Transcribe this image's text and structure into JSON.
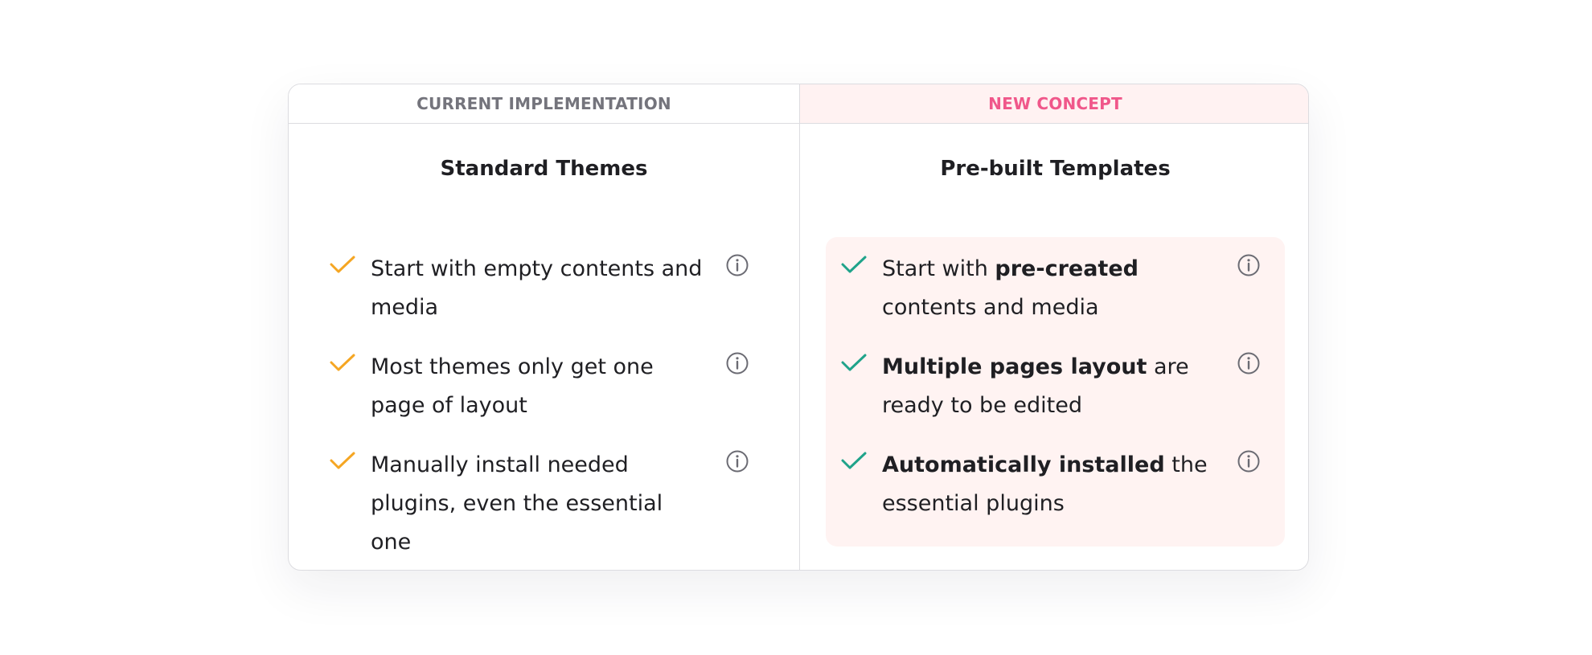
{
  "left_column": {
    "header": "CURRENT IMPLEMENTATION",
    "title": "Standard Themes",
    "features": [
      {
        "text": "Start with empty contents and media"
      },
      {
        "text": "Most themes only get one page of layout"
      },
      {
        "text": "Manually install needed plugins, even the essential one"
      }
    ]
  },
  "right_column": {
    "header": "NEW CONCEPT",
    "title": "Pre-built Templates",
    "features": [
      {
        "pre": "Start with ",
        "bold": "pre-created",
        "post": " contents and media"
      },
      {
        "pre": "",
        "bold": "Multiple pages layout",
        "post": " are ready to be edited"
      },
      {
        "pre": "",
        "bold": "Automatically installed",
        "post": " the essential plugins"
      }
    ]
  },
  "icons": {
    "left_check": "check-icon",
    "right_check": "check-icon",
    "info": "info-icon"
  },
  "colors": {
    "left_check": "#f5a623",
    "right_check": "#1fa38a",
    "new_concept_header": "#f0578a",
    "new_concept_bg": "#fff3f2",
    "current_header": "#74747c",
    "info_icon": "#6b6b73"
  }
}
